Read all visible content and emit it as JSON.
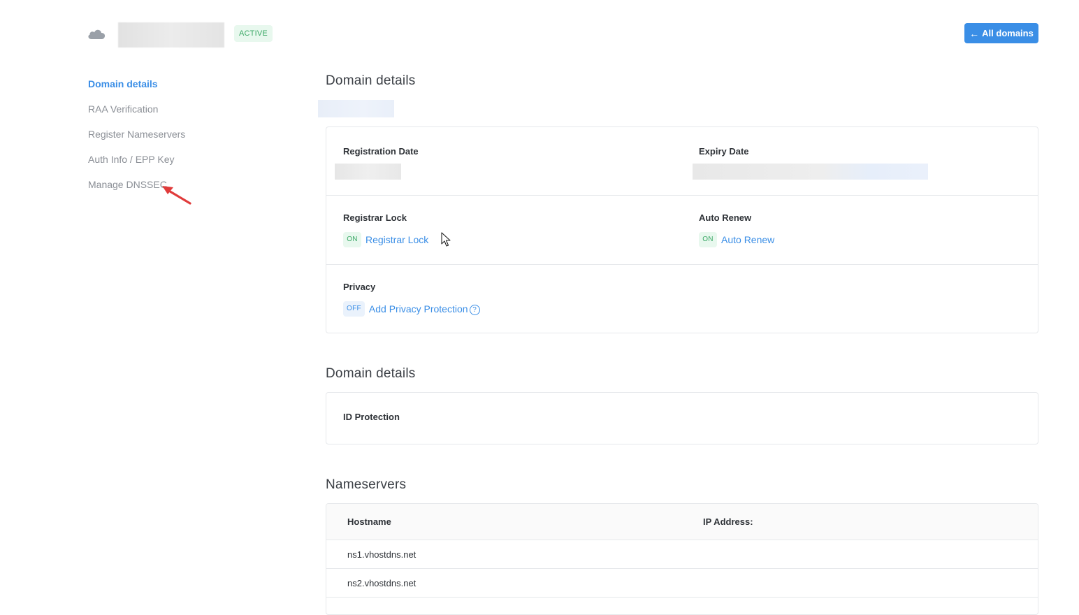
{
  "header": {
    "status_badge": "ACTIVE",
    "all_domains_label": "All domains",
    "back_arrow": "←"
  },
  "sidebar": {
    "items": [
      {
        "label": "Domain details",
        "active": true
      },
      {
        "label": "RAA Verification",
        "active": false
      },
      {
        "label": "Register Nameservers",
        "active": false
      },
      {
        "label": "Auth Info / EPP Key",
        "active": false
      },
      {
        "label": "Manage DNSSEC",
        "active": false
      }
    ]
  },
  "details": {
    "title": "Domain details",
    "registration_date_label": "Registration Date",
    "expiry_date_label": "Expiry Date",
    "registrar_lock": {
      "label": "Registrar Lock",
      "state": "ON",
      "link": "Registrar Lock"
    },
    "auto_renew": {
      "label": "Auto Renew",
      "state": "ON",
      "link": "Auto Renew"
    },
    "privacy": {
      "label": "Privacy",
      "state": "OFF",
      "link": "Add Privacy Protection",
      "help": "?"
    }
  },
  "details2": {
    "title": "Domain details",
    "id_protection_label": "ID Protection"
  },
  "nameservers": {
    "title": "Nameservers",
    "columns": [
      "Hostname",
      "IP Address:"
    ],
    "rows": [
      {
        "hostname": "ns1.vhostdns.net",
        "ip": ""
      },
      {
        "hostname": "ns2.vhostdns.net",
        "ip": ""
      }
    ]
  },
  "colors": {
    "accent": "#3a8ee6",
    "success": "#3aa865",
    "annotation": "#e03b3b"
  },
  "icons": [
    "cloud-icon",
    "arrow-left-icon",
    "help-circle-icon",
    "annotation-arrow-icon",
    "mouse-cursor-icon"
  ]
}
